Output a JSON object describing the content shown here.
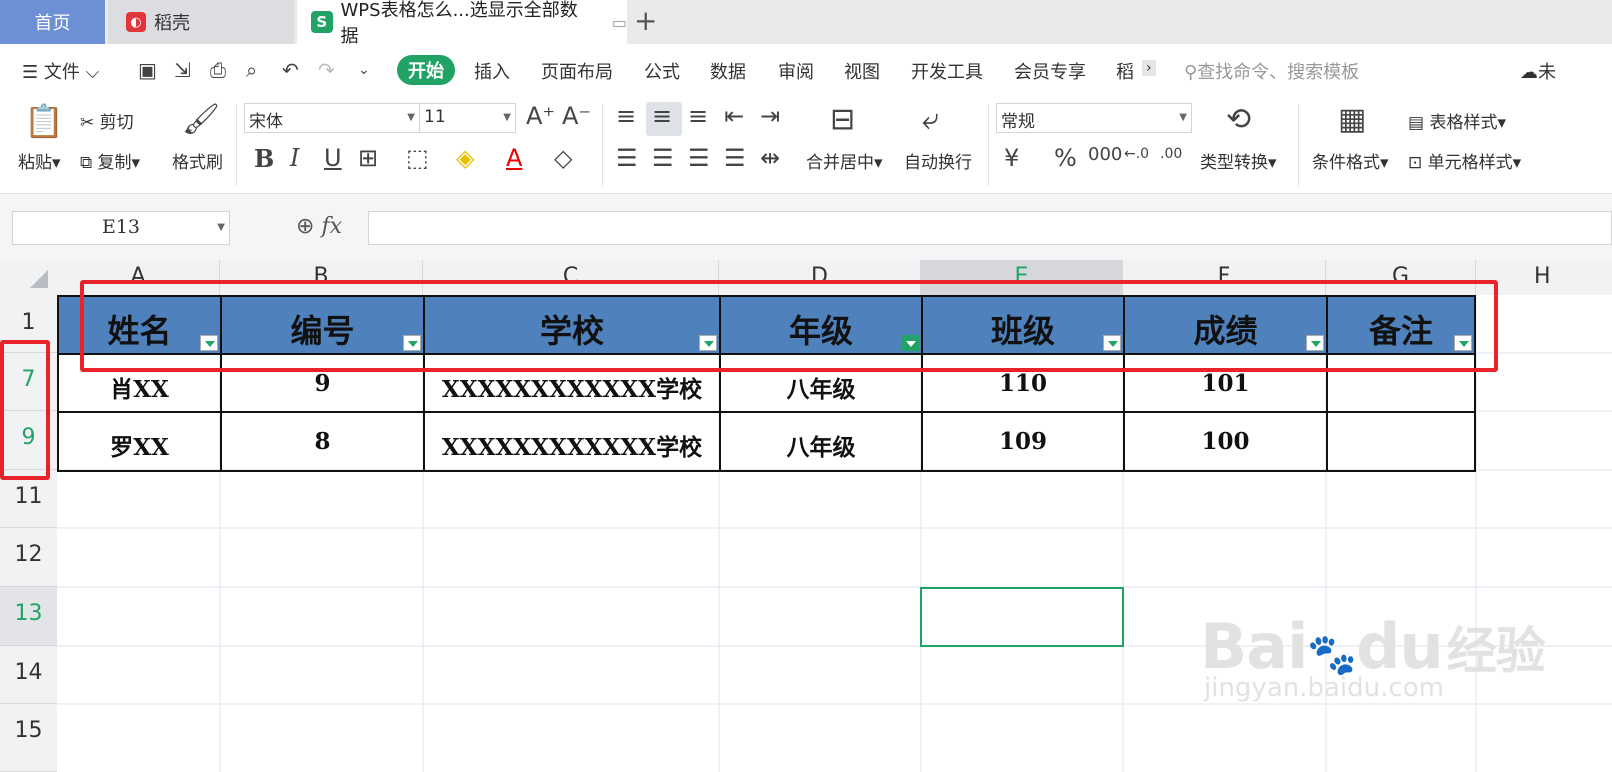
{
  "tabs": {
    "home": "首页",
    "daoke": "稻壳",
    "doc": "WPS表格怎么...选显示全部数据"
  },
  "menu": {
    "file": "文件",
    "items": [
      "开始",
      "插入",
      "页面布局",
      "公式",
      "数据",
      "审阅",
      "视图",
      "开发工具",
      "会员专享",
      "稻"
    ],
    "search": "查找命令、搜索模板",
    "cloud": "未"
  },
  "ribbon": {
    "paste": "粘贴",
    "cut": "剪切",
    "copy": "复制",
    "format_painter": "格式刷",
    "font": "宋体",
    "size": "11",
    "merge": "合并居中",
    "wrap": "自动换行",
    "number_format": "常规",
    "type_convert": "类型转换",
    "cond_format": "条件格式",
    "table_style": "表格样式",
    "cell_style": "单元格样式"
  },
  "formula": {
    "name_box": "E13",
    "fx": "fx",
    "value": ""
  },
  "columns": [
    "A",
    "B",
    "C",
    "D",
    "E",
    "F",
    "G",
    "H"
  ],
  "rows": [
    "1",
    "7",
    "9",
    "11",
    "12",
    "13",
    "14",
    "15"
  ],
  "header": [
    "姓名",
    "编号",
    "学校",
    "年级",
    "班级",
    "成绩",
    "备注"
  ],
  "data": [
    [
      "肖XX",
      "9",
      "XXXXXXXXXXXX学校",
      "八年级",
      "110",
      "101",
      ""
    ],
    [
      "罗XX",
      "8",
      "XXXXXXXXXXXX学校",
      "八年级",
      "109",
      "100",
      ""
    ]
  ],
  "watermark": {
    "brand": "Bai",
    "brand2": "du",
    "cn": "经验",
    "url": "jingyan.baidu.com"
  }
}
